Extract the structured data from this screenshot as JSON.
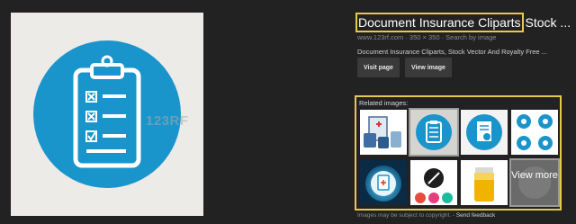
{
  "preview": {
    "watermark": "123RF",
    "circle_color": "#1a95cc"
  },
  "info": {
    "title_highlighted": "Document Insurance Cliparts",
    "title_rest": "Stock ...",
    "meta": "www.123rf.com · 350 × 350 · Search by image",
    "description": "Document Insurance Cliparts, Stock Vector And Royalty Free ..."
  },
  "buttons": {
    "visit_page": "Visit page",
    "view_image": "View image"
  },
  "related": {
    "label": "Related images:",
    "view_more": "View more"
  },
  "footer": {
    "copyright": "Images may be subject to copyright.",
    "separator": " - ",
    "feedback": "Send feedback"
  },
  "colors": {
    "highlight": "#e6c84d",
    "accent_blue": "#1a95cc",
    "background": "#222222"
  }
}
